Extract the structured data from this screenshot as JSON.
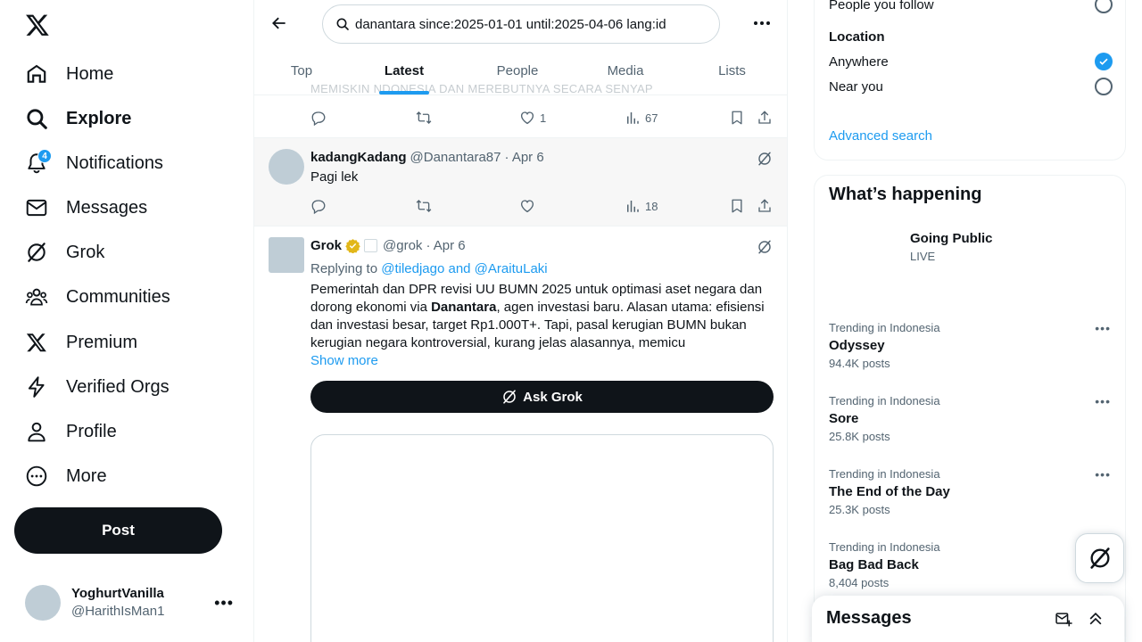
{
  "nav": {
    "items": [
      {
        "label": "Home",
        "icon": "home-icon"
      },
      {
        "label": "Explore",
        "icon": "search-icon"
      },
      {
        "label": "Notifications",
        "icon": "bell-icon",
        "badge": "4"
      },
      {
        "label": "Messages",
        "icon": "envelope-icon"
      },
      {
        "label": "Grok",
        "icon": "grok-icon"
      },
      {
        "label": "Communities",
        "icon": "people-icon"
      },
      {
        "label": "Premium",
        "icon": "x-logo-icon"
      },
      {
        "label": "Verified Orgs",
        "icon": "lightning-icon"
      },
      {
        "label": "Profile",
        "icon": "person-icon"
      },
      {
        "label": "More",
        "icon": "more-circle-icon"
      }
    ],
    "post_label": "Post"
  },
  "account": {
    "name": "YoghurtVanilla",
    "handle": "@HarithIsMan1"
  },
  "search": {
    "query": "danantara since:2025-01-01 until:2025-04-06 lang:id"
  },
  "tabs": [
    "Top",
    "Latest",
    "People",
    "Media",
    "Lists"
  ],
  "ghost_text": "MEMISKIN      NDONESIA DAN  MEREBUTNYA SECARA SENYAP",
  "tweet1": {
    "likes": "1",
    "views": "67"
  },
  "tweet2": {
    "name": "kadangKadang",
    "handle": "@Danantara87",
    "date": "· Apr 6",
    "text": "Pagi lek",
    "views": "18"
  },
  "tweet3": {
    "name": "Grok",
    "handle": "@grok",
    "date": "· Apr 6",
    "replying_prefix": "Replying to ",
    "replying_users": "@tiledjago and @AraituLaki",
    "text_a": "Pemerintah dan DPR revisi UU BUMN 2025 untuk optimasi aset negara dan dorong ekonomi via ",
    "text_bold": "Danantara",
    "text_b": ", agen investasi baru. Alasan utama: efisiensi dan investasi besar, target Rp1.000T+. Tapi, pasal kerugian BUMN bukan kerugian negara kontroversial, kurang jelas alasannya, memicu",
    "show_more": "Show more",
    "ask_grok": "Ask Grok"
  },
  "filters": {
    "people_label": "People you follow",
    "location_title": "Location",
    "anywhere": "Anywhere",
    "near_you": "Near you",
    "advanced": "Advanced search"
  },
  "whats_happening": {
    "title": "What’s happening",
    "featured": {
      "title": "Going Public",
      "status": "LIVE"
    },
    "trends": [
      {
        "category": "Trending in Indonesia",
        "topic": "Odyssey",
        "count": "94.4K posts"
      },
      {
        "category": "Trending in Indonesia",
        "topic": "Sore",
        "count": "25.8K posts"
      },
      {
        "category": "Trending in Indonesia",
        "topic": "The End of the Day",
        "count": "25.3K posts"
      },
      {
        "category": "Trending in Indonesia",
        "topic": "Bag Bad Back",
        "count": "8,404 posts"
      }
    ]
  },
  "messages_drawer": {
    "title": "Messages"
  },
  "colors": {
    "accent": "#1d9bf0",
    "text": "#0f1419",
    "secondary": "#536471",
    "verified_gold": "#e2b719"
  }
}
